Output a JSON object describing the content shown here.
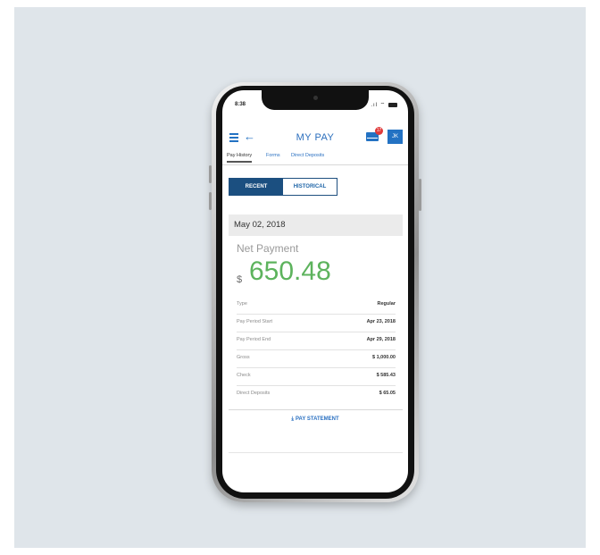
{
  "status_bar": {
    "time": "8:38",
    "icons": ".ıl ⌔"
  },
  "header": {
    "title": "MY PAY",
    "notification_count": "17",
    "avatar_initials": "JK"
  },
  "tabs": [
    {
      "label": "Pay History"
    },
    {
      "label": "Forms"
    },
    {
      "label": "Direct Deposits"
    }
  ],
  "toggle": {
    "recent": "RECENT",
    "historical": "HISTORICAL"
  },
  "payment": {
    "date": "May 02, 2018",
    "net_label": "Net Payment",
    "currency": "$",
    "amount": "650.48",
    "amount_color": "#5db35d"
  },
  "details": [
    {
      "label": "Type",
      "value": "Regular"
    },
    {
      "label": "Pay Period Start",
      "value": "Apr 23, 2018"
    },
    {
      "label": "Pay Period End",
      "value": "Apr 29, 2018"
    },
    {
      "label": "Gross",
      "value": "$ 1,000.00"
    },
    {
      "label": "Check",
      "value": "$ 585.43"
    },
    {
      "label": "Direct Deposits",
      "value": "$ 65.05"
    }
  ],
  "actions": {
    "pay_statement": "PAY STATEMENT",
    "pay_statement_icon": "download-icon"
  },
  "colors": {
    "accent": "#2372c3",
    "toggle_active": "#1b4f80",
    "backdrop": "#dfe5ea"
  }
}
